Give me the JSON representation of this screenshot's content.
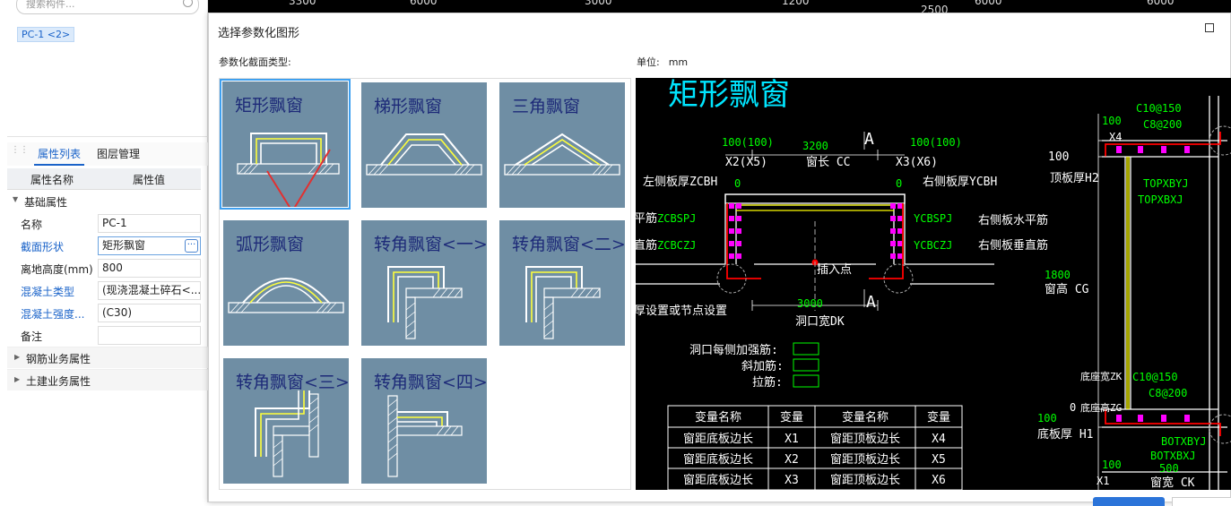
{
  "left_panel": {
    "search_placeholder": "搜索构件...",
    "component_tag": "PC-1 <2>",
    "tabs": [
      "属性列表",
      "图层管理"
    ],
    "headers": {
      "name": "属性名称",
      "value": "属性值"
    },
    "group_basic": "基础属性",
    "props": [
      {
        "k": "名称",
        "v": "PC-1",
        "link": false
      },
      {
        "k": "截面形状",
        "v": "矩形飘窗",
        "link": true
      },
      {
        "k": "离地高度(mm)",
        "v": "800",
        "link": false
      },
      {
        "k": "混凝土类型",
        "v": "(现浇混凝土碎石<...",
        "link": true
      },
      {
        "k": "混凝土强度...",
        "v": "(C30)",
        "link": true
      },
      {
        "k": "备注",
        "v": "",
        "link": false
      }
    ],
    "group_rebar": "钢筋业务属性",
    "group_civil": "土建业务属性"
  },
  "background_numbers": [
    "3300",
    "6000",
    "3000",
    "1200",
    "2500",
    "6000",
    "6000"
  ],
  "dialog": {
    "title": "选择参数化图形",
    "section_label": "参数化截面类型:",
    "unit_label": "单位:",
    "unit_value": "mm",
    "shapes": [
      "矩形飘窗",
      "梯形飘窗",
      "三角飘窗",
      "弧形飘窗",
      "转角飘窗<一>",
      "转角飘窗<二>",
      "转角飘窗<三>",
      "转角飘窗<四>"
    ],
    "selected_shape": "矩形飘窗"
  },
  "cad": {
    "title": "矩形飘窗",
    "marks": {
      "A1": "A",
      "A2": "A"
    },
    "dims": {
      "d100a": "100(100)",
      "d3200": "3200",
      "d100b": "100(100)",
      "x2x5": "X2(X5)",
      "cc": "窗长 CC",
      "x3x6": "X3(X6)",
      "d0a": "0",
      "d0b": "0",
      "d3000": "3000",
      "dk": "洞口宽DK",
      "d1800": "1800",
      "cg": "窗高 CG",
      "d100top": "100",
      "h2": "顶板厚H2",
      "d100bot": "100",
      "h1": "底板厚 H1",
      "d0c": "0",
      "x4": "X4",
      "d100x": "100",
      "d100y": "100",
      "x1": "X1",
      "d500": "500",
      "ck": "窗宽 CK"
    },
    "labels": {
      "zcbh": "左侧板厚ZCBH",
      "ycbh": "右侧板厚YCBH",
      "zcbspj_pre": "平筋",
      "zcbspj": "ZCBSPJ",
      "zcbczj_pre": "直筋",
      "zcbczj": "ZCBCZJ",
      "ycbspj": "YCBSPJ",
      "ycbczj": "YCBCZJ",
      "ycb_h": "右侧板水平筋",
      "ycb_v": "右侧板垂直筋",
      "insert": "插入点",
      "node": "厚设置或节点设置",
      "c10": "C10@150",
      "c8": "C8@200",
      "topxbyj": "TOPXBYJ",
      "topxbxj": "TOPXBXJ",
      "c10b": "C10@150",
      "c8b": "C8@200",
      "botxbyj": "BOTXBYJ",
      "botxbxj": "BOTXBXJ",
      "dzk": "底座宽ZK",
      "dzg": "底座高ZG",
      "hole": "洞口每侧加强筋:",
      "oblique": "斜加筋:",
      "tie": "拉筋:"
    },
    "table": {
      "headers": [
        "变量名称",
        "变量",
        "变量名称",
        "变量"
      ],
      "rows": [
        [
          "窗距底板边长",
          "X1",
          "窗距顶板边长",
          "X4"
        ],
        [
          "窗距底板边长",
          "X2",
          "窗距顶板边长",
          "X5"
        ],
        [
          "窗距底板边长",
          "X3",
          "窗距顶板边长",
          "X6"
        ]
      ]
    }
  },
  "colors": {
    "accent": "#1a63c9",
    "cad_cyan": "#00e5ff",
    "cad_green": "#00ff00",
    "cad_yellow": "#ffff00",
    "cad_magenta": "#ff00ff",
    "cad_red": "#ff0000",
    "thumb_bg": "#6f8ea4"
  }
}
